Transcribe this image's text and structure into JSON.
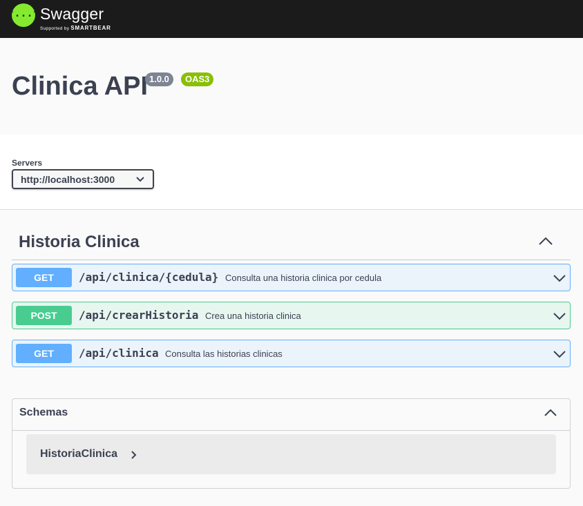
{
  "topbar": {
    "logo_text": "Swagger",
    "logo_sub_prefix": "Supported by",
    "logo_sub_brand": "SMARTBEAR",
    "logo_icon": "swagger-braces-icon",
    "accent": "#85ea2d"
  },
  "info": {
    "title": "Clinica API",
    "version": "1.0.0",
    "oas": "OAS3"
  },
  "servers": {
    "label": "Servers",
    "selected": "http://localhost:3000"
  },
  "tag": {
    "name": "Historia Clinica",
    "expanded": true
  },
  "operations": [
    {
      "method": "GET",
      "path": "/api/clinica/{cedula}",
      "summary": "Consulta una historia clinica por cedula",
      "color": "#61affe"
    },
    {
      "method": "POST",
      "path": "/api/crearHistoria",
      "summary": "Crea una historia clinica",
      "color": "#49cc90"
    },
    {
      "method": "GET",
      "path": "/api/clinica",
      "summary": "Consulta las historias clinicas",
      "color": "#61affe"
    }
  ],
  "schemas": {
    "title": "Schemas",
    "models": [
      {
        "name": "HistoriaClinica"
      }
    ]
  }
}
